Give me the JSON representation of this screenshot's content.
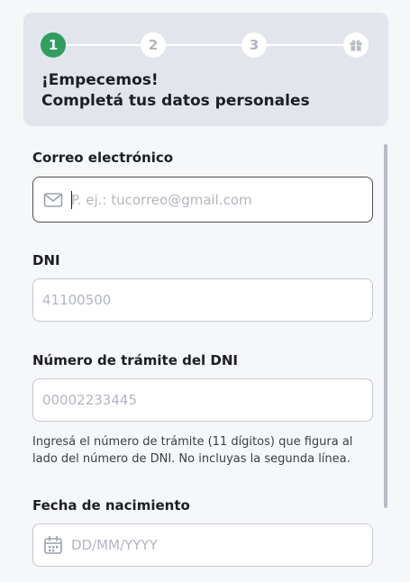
{
  "stepper": {
    "steps": [
      {
        "label": "1",
        "state": "active"
      },
      {
        "label": "2",
        "state": "pending"
      },
      {
        "label": "3",
        "state": "pending"
      },
      {
        "label": "",
        "icon": "gift-icon",
        "state": "pending"
      }
    ],
    "title_line1": "¡Empecemos!",
    "title_line2": "Completá tus datos personales"
  },
  "form": {
    "email": {
      "label": "Correo electrónico",
      "placeholder": "P. ej.: tucorreo@gmail.com",
      "value": "",
      "icon": "mail-icon"
    },
    "dni": {
      "label": "DNI",
      "placeholder": "41100500",
      "value": ""
    },
    "tramite": {
      "label": "Número de trámite del DNI",
      "placeholder": "00002233445",
      "value": "",
      "help": "Ingresá el número de trámite (11 dígitos) que figura al lado del número de DNI. No incluyas la segunda línea."
    },
    "birthdate": {
      "label": "Fecha de nacimiento",
      "placeholder": "DD/MM/YYYY",
      "value": "",
      "icon": "calendar-icon"
    }
  },
  "colors": {
    "accent": "#2f9e5f",
    "card_bg": "#e2e5ec",
    "page_bg": "#f6f7f9",
    "text": "#1c1e24",
    "placeholder": "#b2b6bf"
  }
}
